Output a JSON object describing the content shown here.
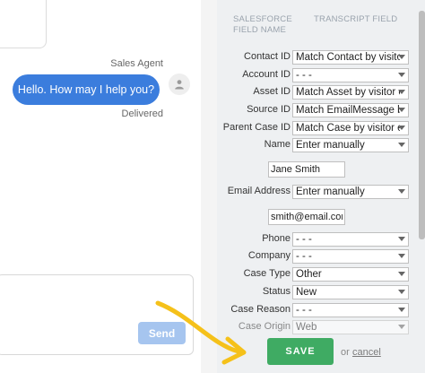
{
  "chat": {
    "agent_name": "Sales Agent",
    "message": "Hello. How may I help you?",
    "status": "Delivered",
    "send_label": "Send"
  },
  "mapping": {
    "header_salesforce": "SALESFORCE FIELD NAME",
    "header_transcript": "TRANSCRIPT FIELD",
    "rows": [
      {
        "label": "Contact ID",
        "value": "Match Contact by visitor"
      },
      {
        "label": "Account ID",
        "value": "- - -"
      },
      {
        "label": "Asset ID",
        "value": "Match Asset by visitor en"
      },
      {
        "label": "Source ID",
        "value": "Match EmailMessage by"
      },
      {
        "label": "Parent Case ID",
        "value": "Match Case by visitor en"
      },
      {
        "label": "Name",
        "value": "Enter manually"
      },
      {
        "label": "Email Address",
        "value": "Enter manually"
      },
      {
        "label": "Phone",
        "value": "- - -"
      },
      {
        "label": "Company",
        "value": "- - -"
      },
      {
        "label": "Case Type",
        "value": "Other"
      },
      {
        "label": "Status",
        "value": "New"
      },
      {
        "label": "Case Reason",
        "value": "- - -"
      },
      {
        "label": "Case Origin",
        "value": "Web"
      }
    ],
    "name_input": "Jane Smith",
    "email_input": "smith@email.com",
    "save_label": "SAVE",
    "or_text": "or",
    "cancel_label": "cancel"
  },
  "colors": {
    "bubble": "#3b7ddd",
    "send_disabled": "#a6c5ef",
    "save": "#3fab63",
    "arrow": "#f5c11a",
    "pane_bg": "#eef0f2"
  },
  "icons": {
    "avatar": "person-icon",
    "select_caret": "chevron-down-icon",
    "pointer": "curved-arrow-icon"
  }
}
